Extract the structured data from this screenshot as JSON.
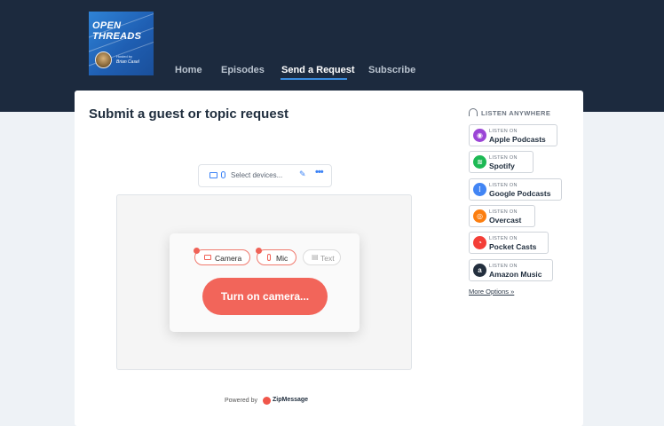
{
  "header": {
    "logo": {
      "title_line1": "OPEN",
      "title_line2": "THREADS",
      "hosted_by": "Hosted by",
      "author": "Brian Casel"
    },
    "nav": [
      {
        "label": "Home",
        "active": false
      },
      {
        "label": "Episodes",
        "active": false
      },
      {
        "label": "Send a Request",
        "active": true
      },
      {
        "label": "Subscribe",
        "active": false
      }
    ],
    "accent": "#3a8de0",
    "bg": "#1c2a3e"
  },
  "main": {
    "title": "Submit a guest or topic request",
    "devices": {
      "placeholder": "Select devices...",
      "icons": [
        "video-icon",
        "mic-icon",
        "edit-icon",
        "more-icon"
      ]
    },
    "recorder": {
      "chips": [
        {
          "label": "Camera",
          "enabled": true,
          "icon": "video-icon"
        },
        {
          "label": "Mic",
          "enabled": true,
          "icon": "mic-icon"
        },
        {
          "label": "Text",
          "enabled": false,
          "icon": "text-icon"
        }
      ],
      "action": "Turn on camera...",
      "action_color": "#f2655a"
    },
    "powered_by": "Powered by",
    "brand": "ZipMessage"
  },
  "sidebar": {
    "heading": "LISTEN ANYWHERE",
    "listen_on": "LISTEN ON",
    "platforms": [
      {
        "name": "Apple Podcasts",
        "icon": "apple-podcasts-icon",
        "color": "#9b45d6"
      },
      {
        "name": "Spotify",
        "icon": "spotify-icon",
        "color": "#1db954"
      },
      {
        "name": "Google Podcasts",
        "icon": "google-podcasts-icon",
        "color": "#4285f4"
      },
      {
        "name": "Overcast",
        "icon": "overcast-icon",
        "color": "#fc7e0f"
      },
      {
        "name": "Pocket Casts",
        "icon": "pocket-casts-icon",
        "color": "#f43e37"
      },
      {
        "name": "Amazon Music",
        "icon": "amazon-music-icon",
        "color": "#232f3e"
      }
    ],
    "more": "More Options »"
  }
}
